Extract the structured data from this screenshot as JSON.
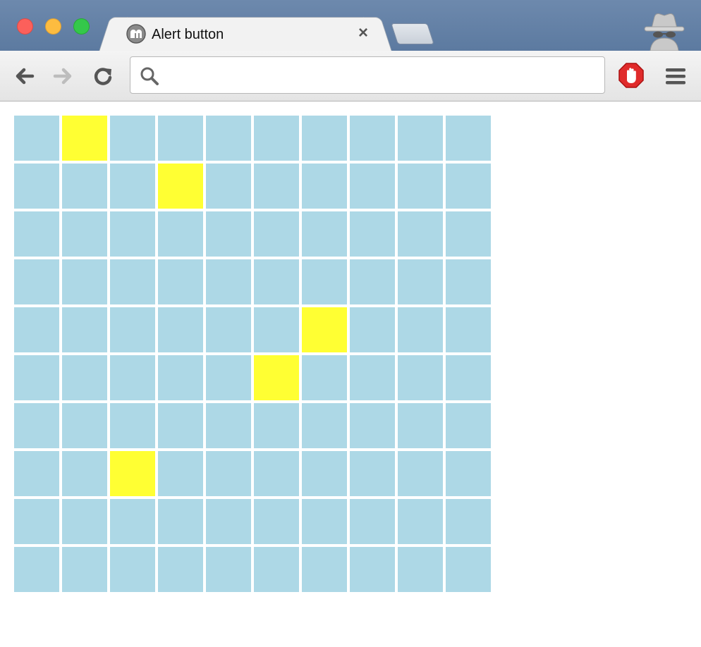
{
  "window": {
    "tab_title": "Alert button",
    "tab_close": "×",
    "traffic_colors": {
      "close": "#fc605b",
      "minimize": "#fdbc40",
      "zoom": "#34c84a"
    }
  },
  "toolbar": {
    "address_value": "",
    "icons": [
      "back-arrow-icon",
      "forward-arrow-icon",
      "reload-icon",
      "search-icon",
      "adblock-icon",
      "menu-icon"
    ]
  },
  "grid": {
    "rows": 10,
    "cols": 10,
    "cell_color": "#add8e6",
    "highlight_color": "#ffff33",
    "highlighted": [
      [
        0,
        1
      ],
      [
        1,
        3
      ],
      [
        4,
        6
      ],
      [
        5,
        5
      ],
      [
        7,
        2
      ]
    ]
  }
}
